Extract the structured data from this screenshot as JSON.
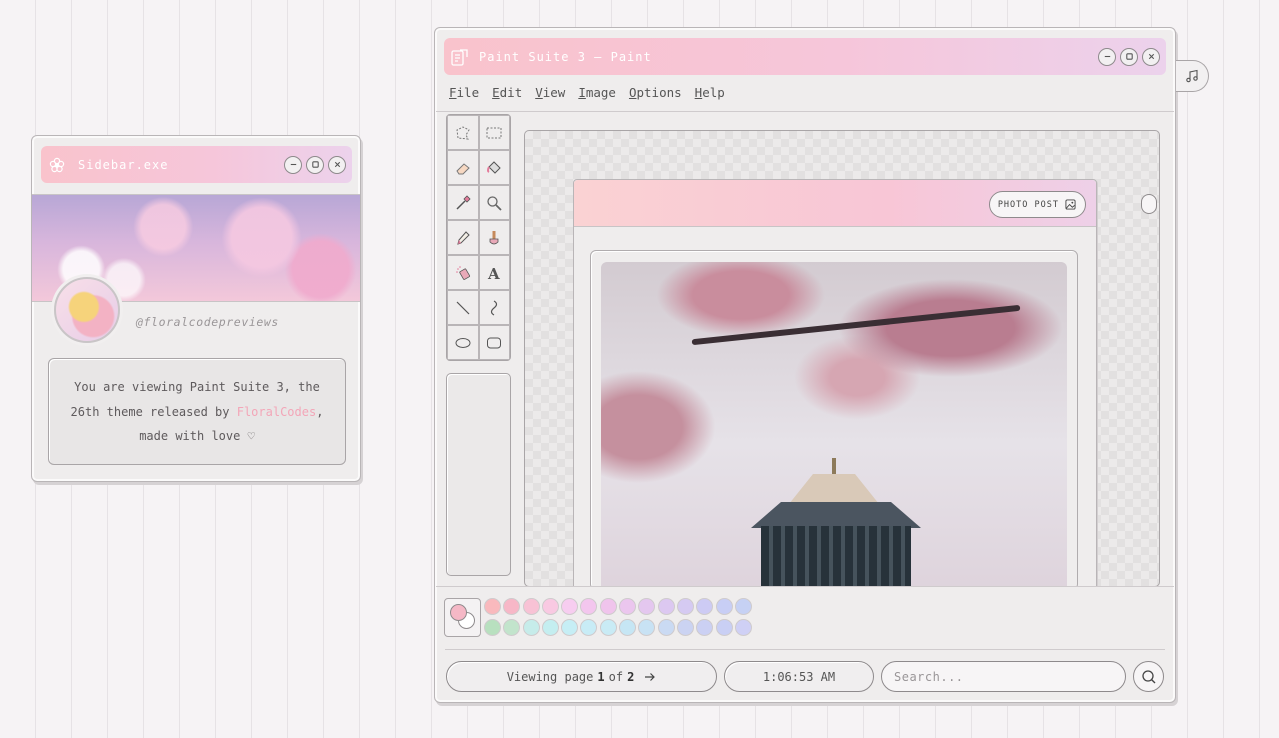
{
  "sidebar": {
    "title": "Sidebar.exe",
    "handle": "@floralcodepreviews",
    "info": {
      "part1": "You are viewing Paint Suite 3, the",
      "part2": "26th theme released by ",
      "link": "FloralCodes",
      "part3": ",",
      "part4": "made with love ♡"
    }
  },
  "paint": {
    "title": "Paint Suite 3 — Paint",
    "menu": [
      "File",
      "Edit",
      "View",
      "Image",
      "Options",
      "Help"
    ],
    "tools": [
      "free-select",
      "rect-select",
      "eraser",
      "fill-bucket",
      "color-picker",
      "magnifier",
      "pencil",
      "brush",
      "airbrush",
      "text",
      "line",
      "curve",
      "ellipse",
      "rounded-rect"
    ],
    "post": {
      "photo_post_label": "PHOTO POST"
    },
    "palette": {
      "foreground": "#f5b8c6",
      "background": "#ffffff",
      "row1": [
        "#f9b9bd",
        "#f7b7c7",
        "#f8c2d5",
        "#f9c9e2",
        "#f7cdf0",
        "#f3c6ee",
        "#f0c4ec",
        "#ebc6ee",
        "#e4c7ef",
        "#dcc8f1",
        "#d5caf2",
        "#cdcbf4",
        "#c8cef5",
        "#c6d1f4"
      ],
      "row2": [
        "#b8e0bf",
        "#c2e4cc",
        "#c6ecea",
        "#c4eef0",
        "#c6eef5",
        "#c8ecf6",
        "#c9ebf5",
        "#c6e6f4",
        "#c8e2f4",
        "#cadaf3",
        "#cbd3f2",
        "#cbd0f3",
        "#c9cff4",
        "#cfd0f5"
      ]
    },
    "footer": {
      "page_prefix": "Viewing page",
      "page_current": "1",
      "page_of": "of",
      "page_total": "2",
      "time": "1:06:53 AM",
      "search_placeholder": "Search..."
    }
  },
  "colors": {
    "accent_pink": "#f6c6da",
    "link_pink": "#f3a6b8"
  }
}
